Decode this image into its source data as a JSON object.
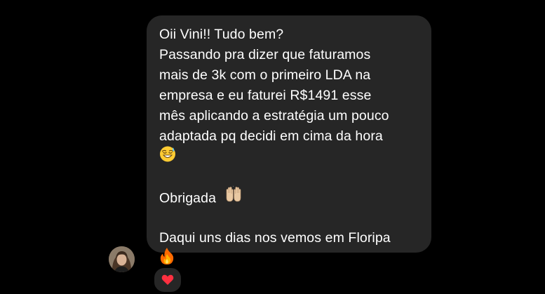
{
  "message": {
    "lines": [
      "Oii Vini!! Tudo bem?",
      "Passando pra dizer que faturamos",
      "mais de 3k com o primeiro LDA na",
      "empresa e eu faturei R$1491 esse",
      "mês aplicando a estratégia um pouco",
      "adaptada pq decidi em cima da hora",
      "",
      "",
      "Obrigada",
      "",
      "Daqui uns dias nos vemos em Floripa",
      ""
    ],
    "emojis": {
      "sweat_smile": "sweat-smile-emoji",
      "raised_hands": "raised-hands-emoji",
      "fire": "fire-emoji"
    }
  },
  "reaction": {
    "icon": "heart-icon",
    "color": "#ff3040"
  },
  "colors": {
    "background": "#000000",
    "bubble": "#262626",
    "text": "#ffffff"
  }
}
